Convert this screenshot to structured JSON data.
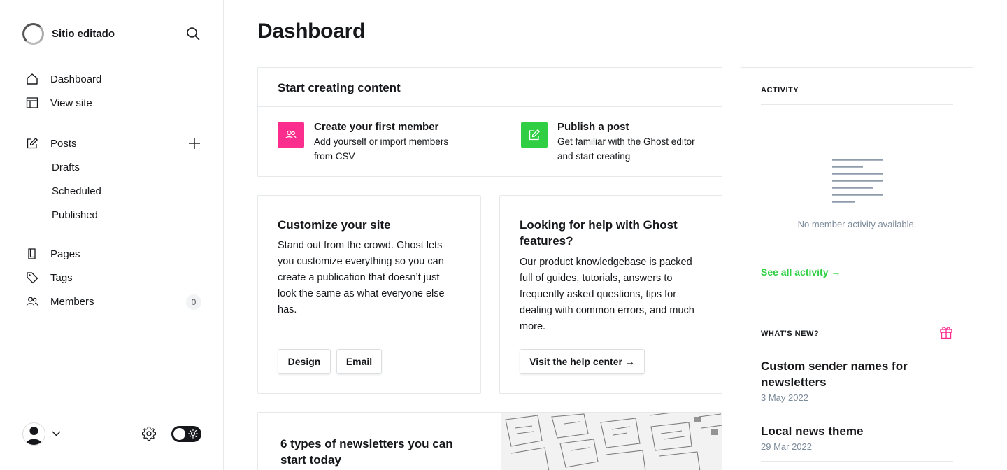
{
  "site": {
    "title": "Sitio editado"
  },
  "nav": {
    "dashboard": "Dashboard",
    "view_site": "View site",
    "posts": "Posts",
    "drafts": "Drafts",
    "scheduled": "Scheduled",
    "published": "Published",
    "pages": "Pages",
    "tags": "Tags",
    "members": "Members",
    "members_count": "0"
  },
  "main": {
    "title": "Dashboard"
  },
  "start_card": {
    "heading": "Start creating content",
    "member": {
      "title": "Create your first member",
      "desc": "Add yourself or import members from CSV"
    },
    "post": {
      "title": "Publish a post",
      "desc": "Get familiar with the Ghost editor and start creating"
    }
  },
  "customize_card": {
    "heading": "Customize your site",
    "body": "Stand out from the crowd. Ghost lets you customize everything so you can create a publication that doesn’t just look the same as what everyone else has.",
    "design_button": "Design",
    "email_button": "Email"
  },
  "help_card": {
    "heading": "Looking for help with Ghost features?",
    "body": "Our product knowledgebase is packed full of guides, tutorials, answers to frequently asked questions, tips for dealing with common errors, and much more.",
    "button": "Visit the help center →"
  },
  "newsletter_card": {
    "heading": "6 types of newsletters you can start today"
  },
  "activity": {
    "label": "ACTIVITY",
    "empty": "No member activity available.",
    "link": "See all activity →"
  },
  "whats_new": {
    "label": "WHAT'S NEW?",
    "items": [
      {
        "title": "Custom sender names for newsletters",
        "date": "3 May 2022"
      },
      {
        "title": "Local news theme",
        "date": "29 Mar 2022"
      }
    ]
  },
  "colors": {
    "member_badge": "#fb2d8d",
    "post_badge": "#30cf43",
    "accent_green": "#30cf43"
  },
  "icons": [
    "search-icon",
    "home-icon",
    "view-site-icon",
    "posts-icon",
    "plus-icon",
    "pages-icon",
    "tag-icon",
    "members-icon",
    "chevron-down-icon",
    "gear-icon",
    "sun-icon",
    "gift-icon"
  ]
}
